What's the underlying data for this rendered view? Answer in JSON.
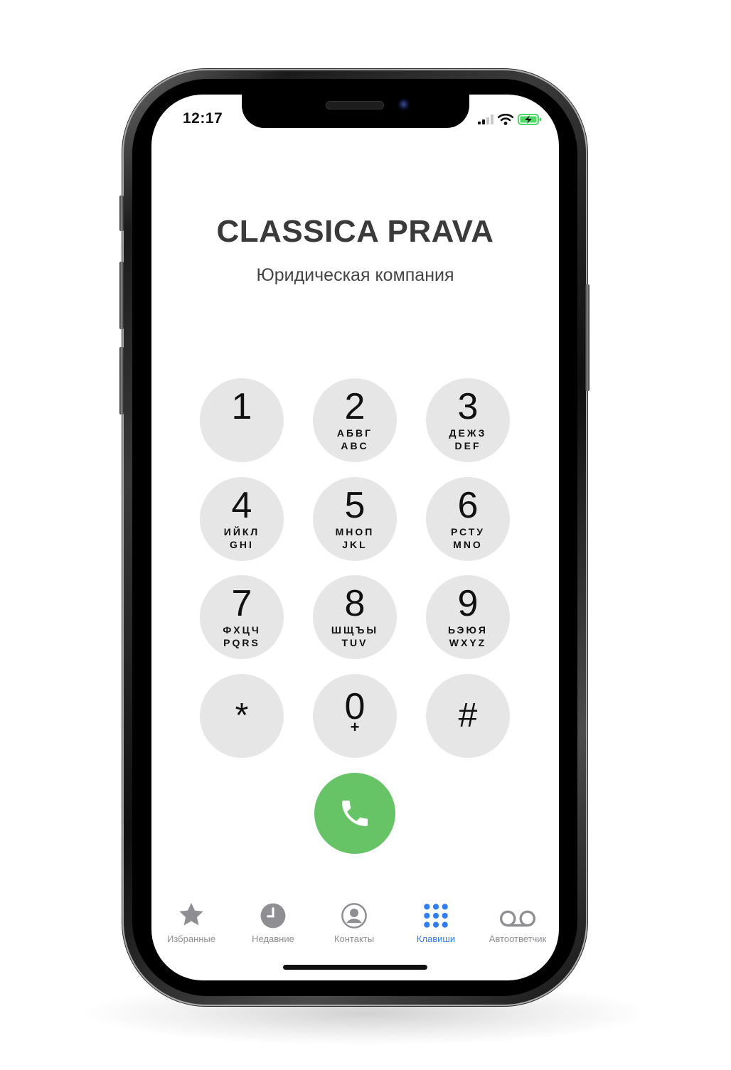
{
  "status_bar": {
    "time": "12:17"
  },
  "header": {
    "title": "CLASSICA PRAVA",
    "subtitle": "Юридическая компания"
  },
  "keypad": [
    {
      "digit": "1",
      "line1": "",
      "line2": ""
    },
    {
      "digit": "2",
      "line1": "АБВГ",
      "line2": "ABC"
    },
    {
      "digit": "3",
      "line1": "ДЕЖЗ",
      "line2": "DEF"
    },
    {
      "digit": "4",
      "line1": "ИЙКЛ",
      "line2": "GHI"
    },
    {
      "digit": "5",
      "line1": "МНОП",
      "line2": "JKL"
    },
    {
      "digit": "6",
      "line1": "РСТУ",
      "line2": "MNO"
    },
    {
      "digit": "7",
      "line1": "ФХЦЧ",
      "line2": "PQRS"
    },
    {
      "digit": "8",
      "line1": "ШЩЪЫ",
      "line2": "TUV"
    },
    {
      "digit": "9",
      "line1": "ЬЭЮЯ",
      "line2": "WXYZ"
    },
    {
      "digit": "*",
      "line1": "",
      "line2": ""
    },
    {
      "digit": "0",
      "line1": "+",
      "line2": ""
    },
    {
      "digit": "#",
      "line1": "",
      "line2": ""
    }
  ],
  "tabs": [
    {
      "label": "Избранные",
      "icon": "star-icon"
    },
    {
      "label": "Недавние",
      "icon": "clock-icon"
    },
    {
      "label": "Контакты",
      "icon": "contact-icon"
    },
    {
      "label": "Клавиши",
      "icon": "keypad-icon",
      "active": true
    },
    {
      "label": "Автоответчик",
      "icon": "voicemail-icon"
    }
  ],
  "colors": {
    "accent": "#2f7ef5",
    "call": "#66c466",
    "key": "#e6e6e6",
    "inactive": "#8e8e93"
  }
}
